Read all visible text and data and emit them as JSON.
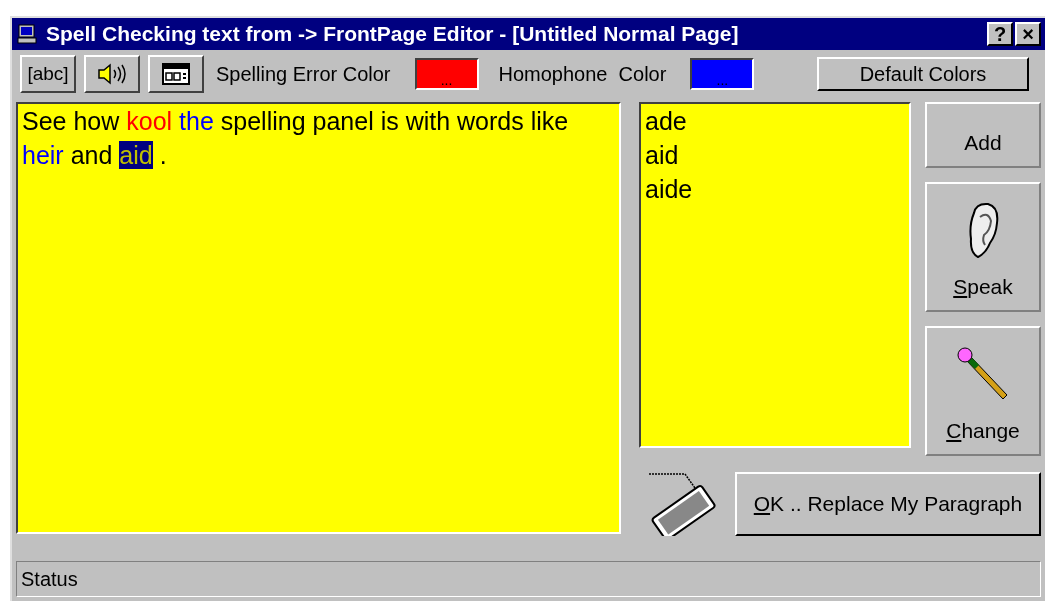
{
  "window": {
    "title": "Spell Checking text from -> FrontPage Editor - [Untitled Normal Page]",
    "controls": {
      "help": "?",
      "close": "×"
    }
  },
  "toolbar": {
    "tools": [
      {
        "kind": "text",
        "label": "[abc]"
      },
      {
        "kind": "speaker"
      },
      {
        "kind": "window"
      }
    ],
    "color_settings": [
      {
        "label": "Spelling Error Color",
        "color": "#ff0000",
        "button_text": "..."
      },
      {
        "label": "Homophone  Color",
        "color": "#0000ff",
        "button_text": "..."
      }
    ],
    "default_button": "Default Colors"
  },
  "editor": {
    "words": [
      {
        "text": "See how",
        "kind": "plain"
      },
      {
        "text": "kool",
        "kind": "error"
      },
      {
        "text": "the",
        "kind": "homophone"
      },
      {
        "text": "spelling panel is with words like",
        "kind": "plain"
      },
      {
        "text": "heir",
        "kind": "homophone"
      },
      {
        "text": "and",
        "kind": "plain"
      },
      {
        "text": "aid",
        "kind": "selected"
      },
      {
        "text": ".",
        "kind": "plain"
      }
    ]
  },
  "suggestions": [
    "ade",
    "aid",
    "aide"
  ],
  "side_buttons": [
    {
      "kind": "text",
      "label": "Add",
      "underline_first": false
    },
    {
      "kind": "ear",
      "label": "Speak",
      "underline_first": true
    },
    {
      "kind": "pencil",
      "label": "Change",
      "underline_first": true
    }
  ],
  "ok_button": {
    "label": "OK .. Replace My Paragraph",
    "underline_first": true
  },
  "status_bar": "Status"
}
